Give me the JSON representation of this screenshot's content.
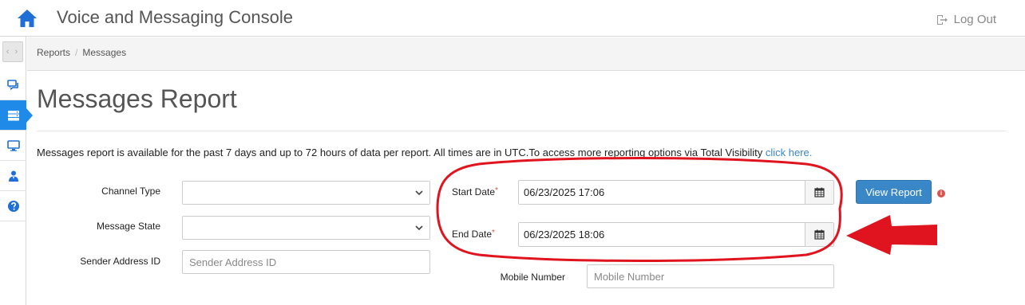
{
  "header": {
    "title": "Voice and Messaging Console",
    "logout_label": "Log Out"
  },
  "breadcrumb": [
    "Reports",
    "Messages"
  ],
  "page": {
    "title": "Messages Report",
    "info_text": "Messages report is available for the past 7 days and up to 72 hours of data per report. All times are in UTC.To access more reporting options via Total Visibility ",
    "info_link": "click here."
  },
  "form": {
    "channel_type_label": "Channel Type",
    "message_state_label": "Message State",
    "sender_label": "Sender Address ID",
    "sender_placeholder": "Sender Address ID",
    "start_date_label": "Start Date",
    "start_date_value": "06/23/2025 17:06",
    "end_date_label": "End Date",
    "end_date_value": "06/23/2025 18:06",
    "required_mark": "*",
    "mobile_label": "Mobile Number",
    "mobile_placeholder": "Mobile Number",
    "view_report_label": "View Report",
    "info_icon_glyph": "i"
  },
  "nav_icons": [
    "chat-icon",
    "reports-icon",
    "monitor-icon",
    "users-icon",
    "help-icon"
  ],
  "colors": {
    "accent": "#1f8ae8",
    "button": "#3a87c8",
    "annotation": "#e0141e",
    "required": "#d9534f"
  }
}
